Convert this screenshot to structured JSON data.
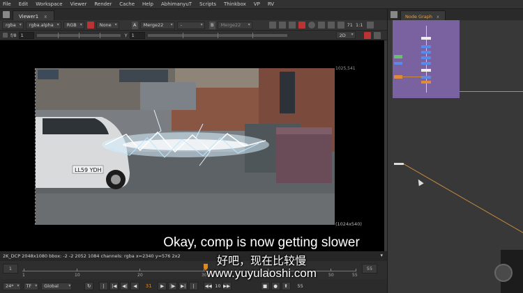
{
  "menu": [
    "File",
    "Edit",
    "Workspace",
    "Viewer",
    "Render",
    "Cache",
    "Help",
    "AbhimanyuT",
    "Scripts",
    "Thinkbox",
    "VP",
    "RV"
  ],
  "viewer_tab": {
    "label": "Viewer1",
    "close": "x"
  },
  "viewer_toolbar": {
    "channels": "rgba",
    "alpha": "rgba.alpha",
    "colorspace": "RGB",
    "none_label": "None",
    "a_label": "A",
    "a_input": "Merge22",
    "mid_dd": "-",
    "b_label": "B",
    "b_input": "Merge22",
    "zoom": "71",
    "ratio": "1:1"
  },
  "viewer_toolbar2": {
    "fstop": "f/8",
    "gain": "1",
    "y_label": "Y",
    "gamma": "1",
    "mode": "2D"
  },
  "image": {
    "format_top_right": "1025,541",
    "format_bottom_right": "(1024x540)",
    "license_plate": "LL59 YDH"
  },
  "info_bar": {
    "text": "2K_DCP 2048x1080  bbox: -2 -2 2052 1084 channels: rgba  x=2340 y=576 2x2"
  },
  "timeline": {
    "start": "1",
    "end": "55",
    "labels": [
      "1",
      "10",
      "20",
      "30",
      "40",
      "50",
      "55"
    ],
    "current": 31
  },
  "playbar": {
    "fps": "24*",
    "tf": "TF",
    "global": "Global",
    "frame": "31",
    "step": "10",
    "end": "55"
  },
  "subtitles": {
    "en": "Okay, comp is now getting slower",
    "zh": "好吧，现在比较慢",
    "watermark": "www.yuyulaoshi.com"
  },
  "node_graph": {
    "tab_label": "Node Graph",
    "close": "x"
  }
}
